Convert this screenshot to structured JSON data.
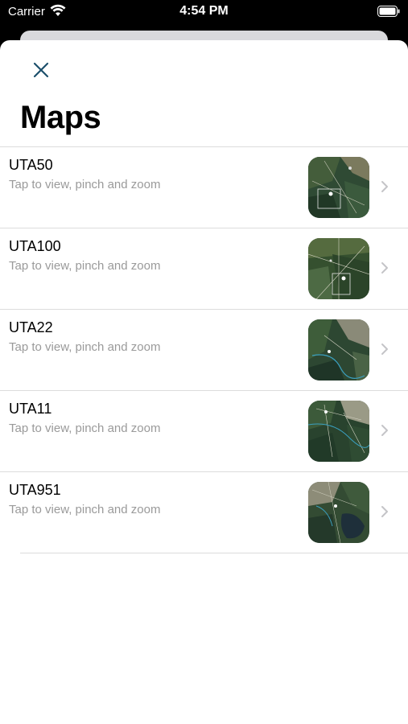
{
  "status": {
    "carrier": "Carrier",
    "time": "4:54 PM"
  },
  "sheet": {
    "title": "Maps",
    "close_icon": "close-icon"
  },
  "maps": [
    {
      "name": "UTA50",
      "subtitle": "Tap to view, pinch and zoom"
    },
    {
      "name": "UTA100",
      "subtitle": "Tap to view, pinch and zoom"
    },
    {
      "name": "UTA22",
      "subtitle": "Tap to view, pinch and zoom"
    },
    {
      "name": "UTA11",
      "subtitle": "Tap to view, pinch and zoom"
    },
    {
      "name": "UTA951",
      "subtitle": "Tap to view, pinch and zoom"
    }
  ],
  "colors": {
    "accent": "#1c4f6b",
    "separator": "#dcdcdc",
    "subtitle": "#9a9a9a"
  }
}
